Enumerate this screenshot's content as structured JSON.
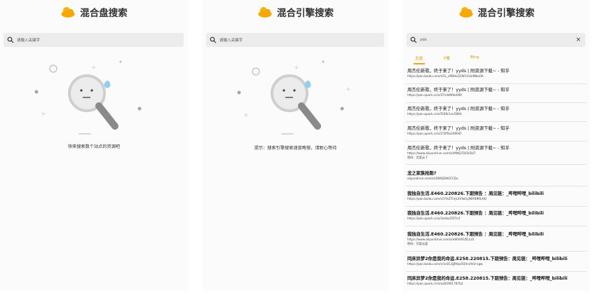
{
  "colors": {
    "accent": "#f0a500",
    "search_bg": "#ececec"
  },
  "panel1": {
    "title": "混合盘搜索",
    "search_placeholder": "请输入关键字",
    "hint": "快来搜索数个站点的资源吧"
  },
  "panel2": {
    "title": "混合引擎搜索",
    "search_placeholder": "请输入关键字",
    "hint": "提示：搜索引擎搜索速度略慢，请耐心等待"
  },
  "panel3": {
    "title": "混合引擎搜索",
    "search_value": "yds",
    "clear_label": "×",
    "tabs": [
      "无追",
      "F搜",
      "Bing"
    ],
    "results": [
      {
        "title": "周杰伦新歌，终于来了！yyds | 附资源下载~ - 知乎",
        "url": "https://pan.baidu.com/s/1L_zPBHvQ1W11UzdNbv0A",
        "pwd": ""
      },
      {
        "title": "周杰伦新歌，终于来了！yyds | 附资源下载~ - 知乎",
        "url": "https://pan.quark.cn/s/37cdd0fde090",
        "pwd": ""
      },
      {
        "title": "周杰伦新歌，终于来了！yyds | 附资源下载~ - 知乎",
        "url": "https://pan.quark.cn/s/f109c1ec5894",
        "pwd": ""
      },
      {
        "title": "周杰伦新歌，终于来了！yyds | 附资源下载~ - 知乎",
        "url": "https://pan.quark.cn/s/276f5a24904f",
        "pwd": ""
      },
      {
        "title": "周杰伦新歌，终于来了！yyds | 附资源下载~ - 知乎",
        "url": "https://www.aliyundrive.com/s/VANQ7DGhDU7",
        "pwd": "密码：百度云下"
      },
      {
        "title": "龙之家族抢跑?",
        "url": "aliyundrive.com/s/sDWQEWGFCDu",
        "pwd": ""
      },
      {
        "title": "我独自生活.E460.220826.下期预告 ：周见链：_哔哩哔哩_bilibili",
        "url": "https://pan.baidu.com/s/1YkZTmjLXVlwUyN0F89RLHQ",
        "pwd": ""
      },
      {
        "title": "我独自生活.E460.220826.下期预告 ：周见链：_哔哩哔哩_bilibili",
        "url": "https://pan.quark.cn/s/3eeba25f7c4",
        "pwd": ""
      },
      {
        "title": "我独自生活.E460.220826.下期预告 ：周见链：_哔哩哔哩_bilibili",
        "url": "https://www.aliyundrive.com/s/eWVkRU5LLa5",
        "pwd": "密码：百度云盘"
      },
      {
        "title": "同床异梦2你是我的命运.E258.220815.下期预告：周见链：_哔哩哔哩_bilibili",
        "url": "https://pan.baidu.com/s/1n013JjRfqv5QVnzYeU-sgw",
        "pwd": ""
      },
      {
        "title": "同床异梦2你是我的命运.E258.220815.下期预告：周见链：_哔哩哔哩_bilibili",
        "url": "https://pan.quark.cn/s/a2b5901787b2",
        "pwd": ""
      }
    ]
  }
}
